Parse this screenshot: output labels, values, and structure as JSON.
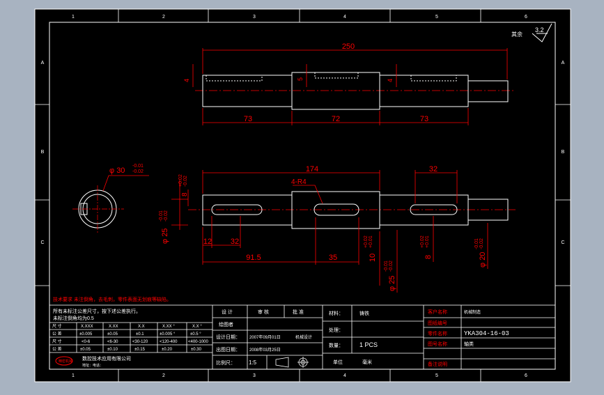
{
  "colors": {
    "viewport_bg": "#a8b3c1",
    "sheet_bg": "#000000",
    "frame": "#ffffff",
    "dimension": "#ff0000",
    "centerline": "#ff0000",
    "part": "#ffffff"
  },
  "zones": {
    "columns": [
      "1",
      "2",
      "3",
      "4",
      "5",
      "6"
    ],
    "rows": [
      "A",
      "B",
      "C"
    ]
  },
  "roughness": {
    "label": "其余",
    "value": "3.2"
  },
  "top_view": {
    "overall": "250",
    "seg_left": "73",
    "seg_mid": "72",
    "seg_right": "73",
    "depth_left": "4",
    "depth_mid": "5",
    "depth_right": "4"
  },
  "main_view": {
    "len_174": "174",
    "len_32": "32",
    "fillet": "4-R4",
    "left_tol_upper": "+0.02",
    "left_tol_lower": "-0.02",
    "left_8": "8",
    "left_dia_upper": "-0.01",
    "left_dia_lower": "-0.02",
    "left_dia": "φ 25",
    "dim_12": "12",
    "dim_32b": "32",
    "dim_915": "91.5",
    "dim_35": "35",
    "dim_10": "10",
    "dim_10_tol_upper": "+0.02",
    "dim_10_tol_lower": "+0.01",
    "dim_25b": "φ 25",
    "dim_25b_tol_upper": "-0.01",
    "dim_25b_tol_lower": "-0.02",
    "dim_8b": "8",
    "dim_8b_tol_upper": "+0.02",
    "dim_8b_tol_lower": "+0.01",
    "dim_20": "φ 20",
    "dim_20_tol_upper": "-0.01",
    "dim_20_tol_lower": "-0.02"
  },
  "section_view": {
    "dia": "φ 30",
    "tol_upper": "-0.01",
    "tol_lower": "-0.02"
  },
  "tech_notes": {
    "title": "技术要求",
    "text": "未注倒角，去毛刺，零件表面无划痕等缺陷。"
  },
  "title_block": {
    "tolerance_note_1": "所有未标注公差尺寸，按下述公差执行。",
    "tolerance_note_2": "未标注倒角均为0.5",
    "tol_header": [
      "尺 寸",
      "X.XXX",
      "X.XX",
      "X.X",
      "X.XX °",
      "X.X °"
    ],
    "tol_row1": [
      "公 差",
      "±0.005",
      "±0.05",
      "±0.1",
      "±0.005 °",
      "±0.5 °"
    ],
    "tol_row2": [
      "尺 寸",
      "<0-6",
      "<6-30",
      "<30-120",
      "<120-400",
      "<400-1000"
    ],
    "tol_row3": [
      "公 差",
      "±0.05",
      "±0.10",
      "±0.15",
      "±0.20",
      "±0.30"
    ],
    "company": "数控技术应用有限公司",
    "company_sub": "地址：电话：",
    "stamp": "精密机械",
    "sign_design": "设 计",
    "sign_review": "审 核",
    "sign_approve": "批 准",
    "drawer": "绘图者",
    "design_date_label": "设计日期：",
    "design_date": "2007年09月01日",
    "design_place": "机械设计",
    "draw_date_label": "出图日期：",
    "draw_date": "2008年03月25日",
    "scale_label": "比例尺：",
    "scale": "1:5",
    "material_label": "材料：",
    "material": "铸铁",
    "finish_label": "处理：",
    "qty_label": "数量：",
    "qty": "1 PCS",
    "unit_label": "单位",
    "unit_value": "毫米",
    "client_label": "客户名称",
    "client": "机械制造",
    "drawing_no_label": "图纸编号",
    "drawing_no": "YKA304-16-03",
    "part_name_label": "零件名称",
    "part_name": "轴类",
    "drawing_name_label": "图号名称",
    "remark_label": "备注说明"
  }
}
